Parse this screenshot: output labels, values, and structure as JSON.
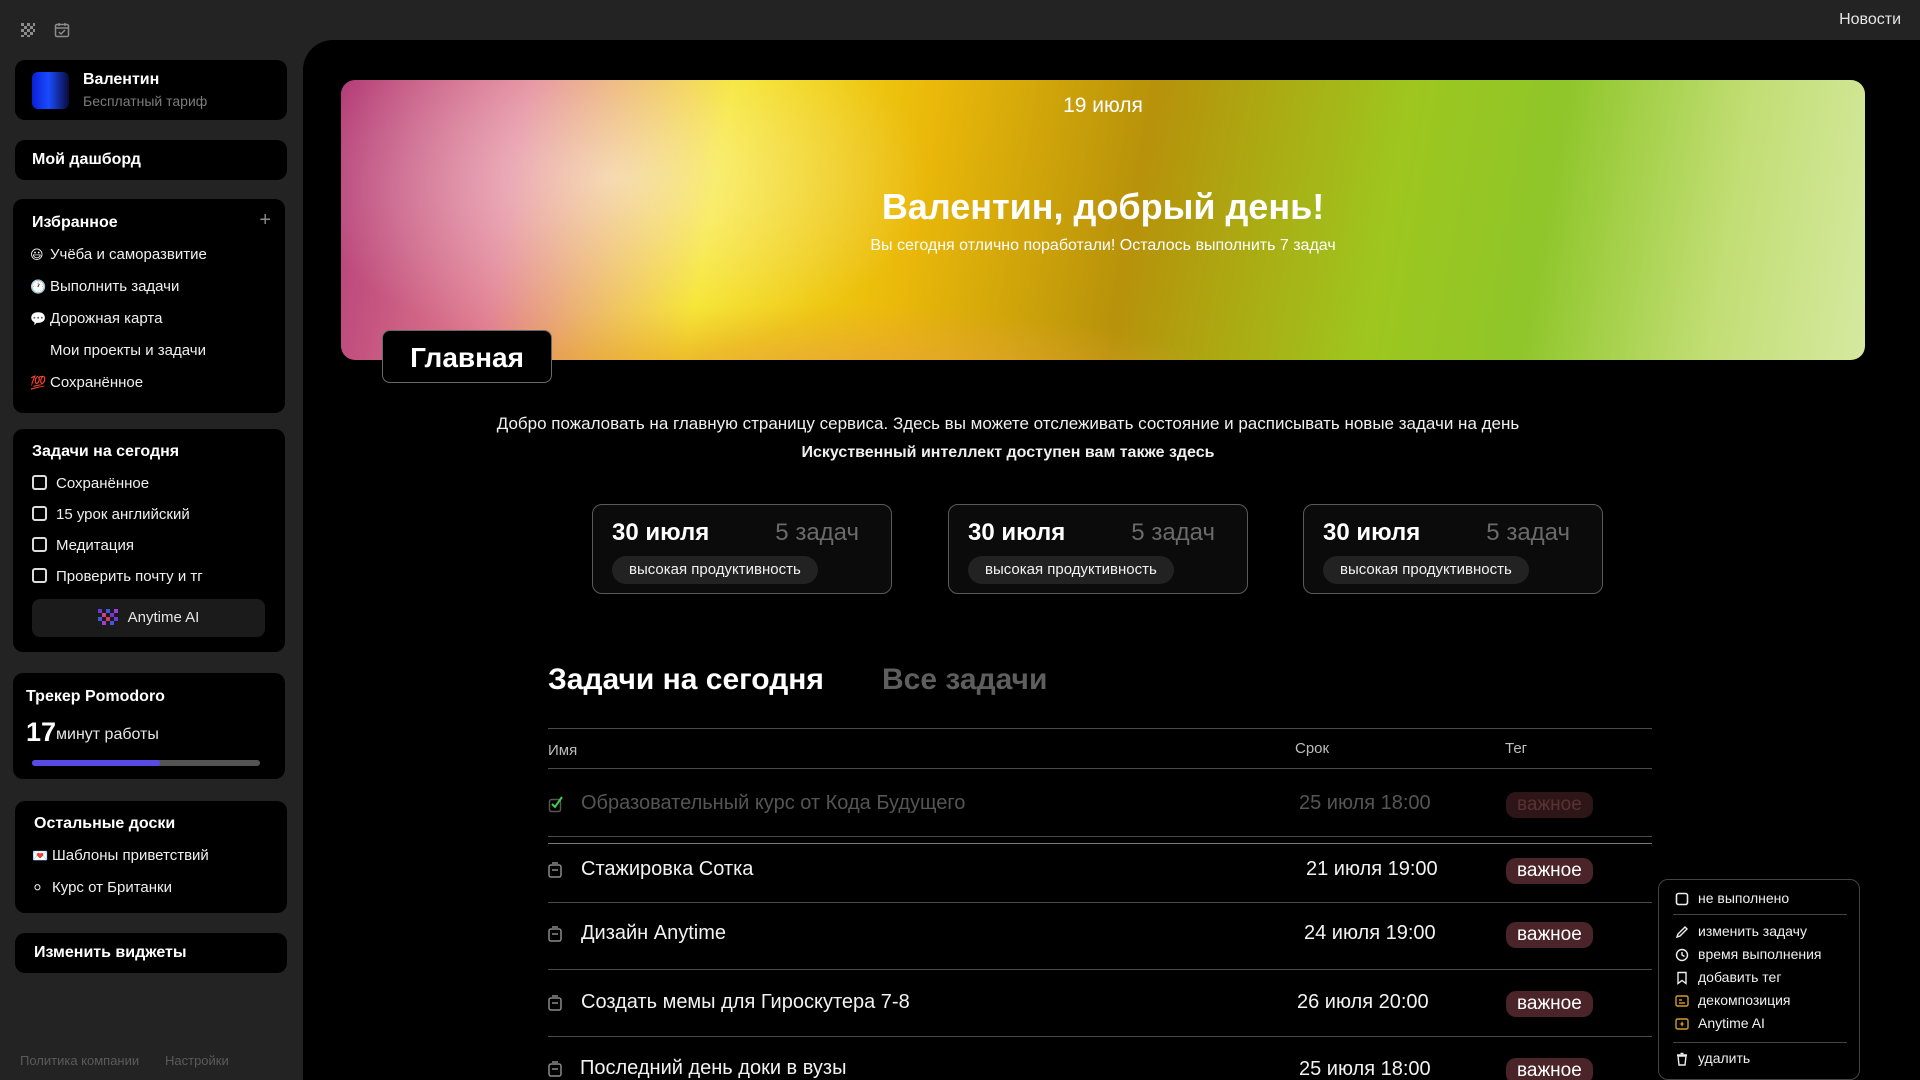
{
  "topbar": {
    "news": "Новости"
  },
  "profile": {
    "name": "Валентин",
    "plan": "Бесплатный тариф"
  },
  "dashboard_label": "Мой дашборд",
  "favorites": {
    "title": "Избранное",
    "add_label": "+",
    "items": [
      {
        "emoji": "😃",
        "label": "Учёба и саморазвитие"
      },
      {
        "emoji": "🕐",
        "label": "Выполнить задачи"
      },
      {
        "emoji": "💬",
        "label": "Дорожная карта"
      },
      {
        "emoji": "",
        "label": "Мои проекты и задачи"
      },
      {
        "emoji": "💯",
        "label": "Сохранённое"
      }
    ]
  },
  "today_tasks": {
    "title": "Задачи на сегодня",
    "items": [
      "Сохранённое",
      "15 урок английский",
      "Медитация",
      "Проверить почту и тг"
    ],
    "ai_button": "Anytime AI"
  },
  "pomodoro": {
    "title": "Трекер Pomodoro",
    "value": "17",
    "unit": "минут работы",
    "progress": 0.56
  },
  "other_boards": {
    "title": "Остальные доски",
    "items": [
      {
        "emoji": "💌",
        "label": "Шаблоны приветствий"
      },
      {
        "emoji": "⚪",
        "label": "Курс от Британки"
      }
    ]
  },
  "change_widgets": "Изменить виджеты",
  "footer": {
    "policy": "Политика компании",
    "settings": "Настройки"
  },
  "hero": {
    "date": "19 июля",
    "greeting": "Валентин, добрый день!",
    "subtitle": "Вы сегодня отлично поработали! Осталось выполнить 7 задач"
  },
  "page_tag": "Главная",
  "welcome_text": "Добро пожаловать на главную страницу сервиса. Здесь вы можете отслеживать состояние и расписывать новые задачи на день",
  "ai_note": "Искуственный интеллект доступен вам также здесь",
  "stats": [
    {
      "date": "30 июля",
      "count": "5 задач",
      "label": "высокая продуктивность"
    },
    {
      "date": "30 июля",
      "count": "5 задач",
      "label": "высокая продуктивность"
    },
    {
      "date": "30 июля",
      "count": "5 задач",
      "label": "высокая продуктивность"
    }
  ],
  "tabs": {
    "today": "Задачи на сегодня",
    "all": "Все задачи"
  },
  "table": {
    "headers": {
      "name": "Имя",
      "deadline": "Срок",
      "tag": "Тег"
    },
    "rows": [
      {
        "name": "Образовательный курс от Кода Будущего",
        "deadline": "25 июля 18:00",
        "tag": "важное",
        "done": true
      },
      {
        "name": "Стажировка Сотка",
        "deadline": "21 июля 19:00",
        "tag": "важное",
        "done": false
      },
      {
        "name": "Дизайн Anytime",
        "deadline": "24 июля 19:00",
        "tag": "важное",
        "done": false
      },
      {
        "name": "Создать мемы для Гироскутера 7-8",
        "deadline": "26 июля 20:00",
        "tag": "важное",
        "done": false
      },
      {
        "name": "Последний день доки в вузы",
        "deadline": "25 июля 18:00",
        "tag": "важное",
        "done": false
      }
    ]
  },
  "context_menu": {
    "not_done": "не выполнено",
    "edit": "изменить задачу",
    "time": "время выполнения",
    "add_tag": "добавить тег",
    "decompose": "декомпозиция",
    "ai": "Anytime AI",
    "delete": "удалить"
  },
  "colors": {
    "accent": "#5a4ae3",
    "tag_bg": "#4a2428",
    "background": "#000000",
    "sidebar_bg": "#232323"
  }
}
